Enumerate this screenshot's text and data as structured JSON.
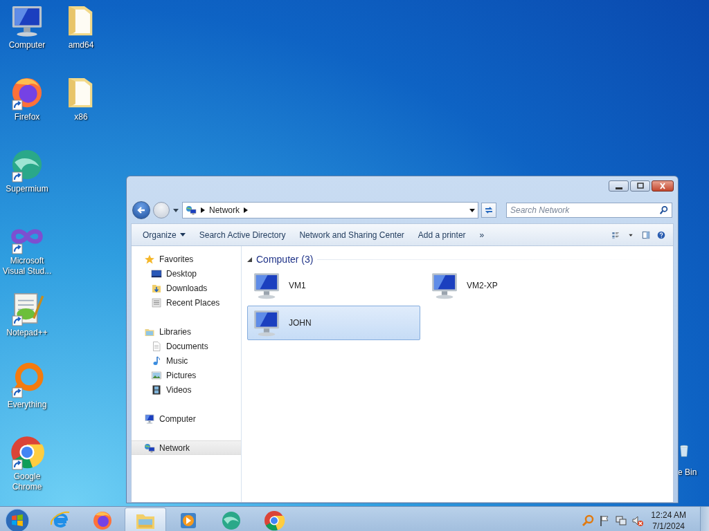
{
  "desktop": {
    "columns": [
      [
        {
          "label": "Computer",
          "kind": "computer",
          "shortcut": false
        },
        {
          "label": "Firefox",
          "kind": "firefox",
          "shortcut": true
        },
        {
          "label": "Supermium",
          "kind": "supermium",
          "shortcut": true
        },
        {
          "label": "Microsoft Visual Stud...",
          "kind": "vs",
          "shortcut": true
        },
        {
          "label": "Notepad++",
          "kind": "notepad",
          "shortcut": true
        },
        {
          "label": "Everything",
          "kind": "everything",
          "shortcut": true
        },
        {
          "label": "Google Chrome",
          "kind": "chrome",
          "shortcut": true
        }
      ],
      [
        {
          "label": "amd64",
          "kind": "folder",
          "shortcut": false
        },
        {
          "label": "x86",
          "kind": "folder",
          "shortcut": false
        }
      ]
    ],
    "recycle_bin": {
      "label": "e Bin"
    }
  },
  "explorer": {
    "address": {
      "crumbs": [
        "Network"
      ]
    },
    "search": {
      "placeholder": "Search Network"
    },
    "toolbar": [
      {
        "label": "Organize",
        "has_menu": true
      },
      {
        "label": "Search Active Directory",
        "has_menu": false
      },
      {
        "label": "Network and Sharing Center",
        "has_menu": false
      },
      {
        "label": "Add a printer",
        "has_menu": false
      }
    ],
    "toolbar_overflow": "»",
    "sidebar": [
      {
        "label": "Favorites",
        "kind": "star",
        "selected": false,
        "children": [
          {
            "label": "Desktop",
            "kind": "desktop",
            "selected": false
          },
          {
            "label": "Downloads",
            "kind": "downloads",
            "selected": false
          },
          {
            "label": "Recent Places",
            "kind": "recent",
            "selected": false
          }
        ]
      },
      {
        "label": "Libraries",
        "kind": "libraries",
        "selected": false,
        "children": [
          {
            "label": "Documents",
            "kind": "documents",
            "selected": false
          },
          {
            "label": "Music",
            "kind": "music",
            "selected": false
          },
          {
            "label": "Pictures",
            "kind": "pictures",
            "selected": false
          },
          {
            "label": "Videos",
            "kind": "videos",
            "selected": false
          }
        ]
      },
      {
        "label": "Computer",
        "kind": "computer",
        "selected": false
      },
      {
        "label": "Network",
        "kind": "network",
        "selected": true
      }
    ],
    "group": {
      "title": "Computer (3)",
      "expanded": true,
      "items": [
        {
          "label": "VM1",
          "selected": false
        },
        {
          "label": "VM2-XP",
          "selected": false
        },
        {
          "label": "JOHN",
          "selected": true
        }
      ]
    }
  },
  "taskbar": {
    "apps": [
      {
        "kind": "ie",
        "selected": false
      },
      {
        "kind": "firefox",
        "selected": false
      },
      {
        "kind": "explorer",
        "selected": true
      },
      {
        "kind": "media",
        "selected": false
      },
      {
        "kind": "supermium",
        "selected": false
      },
      {
        "kind": "chrome",
        "selected": false
      }
    ],
    "time": "12:24 AM",
    "date": "7/1/2024"
  }
}
